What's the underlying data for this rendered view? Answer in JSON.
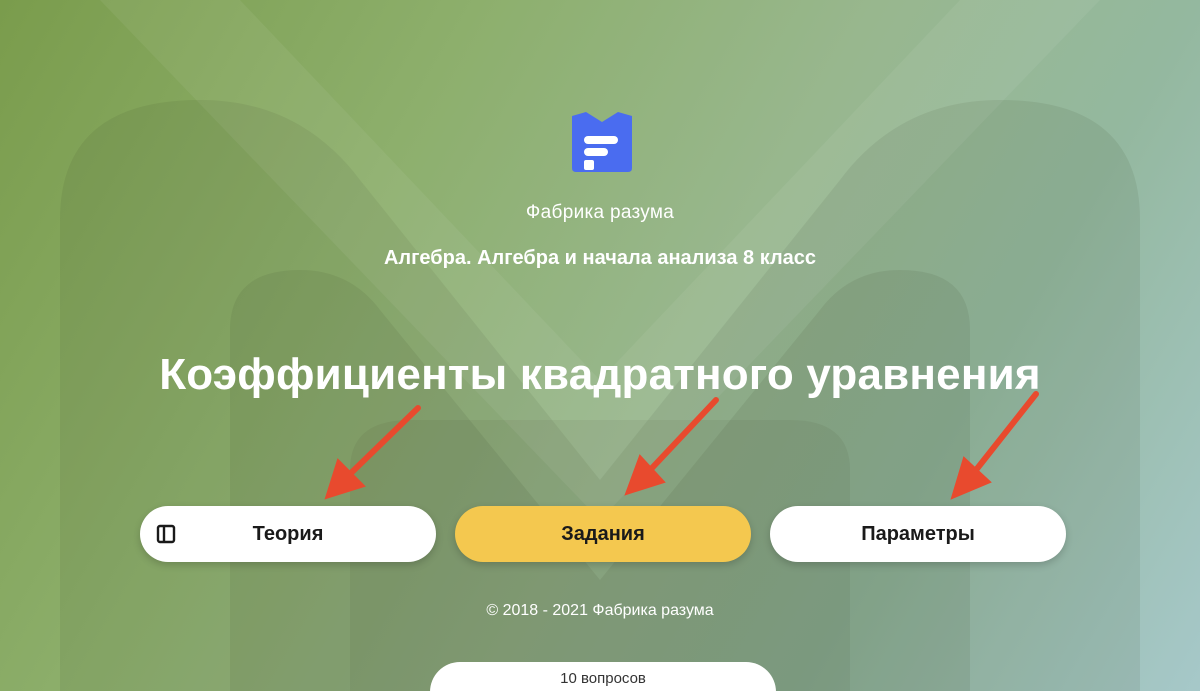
{
  "brand": {
    "name": "Фабрика разума",
    "logo_color": "#4a6cf0"
  },
  "course": {
    "subject": "Алгебра. Алгебра и начала анализа 8 класс",
    "topic": "Коэффициенты квадратного уравнения"
  },
  "actions": {
    "theory_label": "Теория",
    "tasks_label": "Задания",
    "params_label": "Параметры",
    "tasks_color": "#f4c84f",
    "arrow_color": "#e84a2e"
  },
  "footer": {
    "copyright": "© 2018 - 2021 Фабрика разума",
    "questions_count": "10 вопросов"
  },
  "icons": [
    "logo-icon",
    "book-icon",
    "arrow-icon"
  ]
}
